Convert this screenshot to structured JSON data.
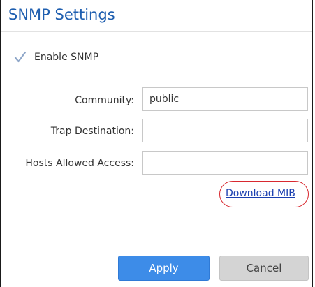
{
  "panel": {
    "title": "SNMP Settings"
  },
  "enable_snmp": {
    "label": "Enable SNMP",
    "checked": true
  },
  "fields": {
    "community": {
      "label": "Community:",
      "value": "public"
    },
    "trap_destination": {
      "label": "Trap Destination:",
      "value": ""
    },
    "hosts_allowed_access": {
      "label": "Hosts Allowed Access:",
      "value": ""
    }
  },
  "links": {
    "download_mib": "Download MIB"
  },
  "buttons": {
    "apply": "Apply",
    "cancel": "Cancel"
  },
  "colors": {
    "title": "#1f5fb0",
    "apply_button": "#3d8ce8",
    "cancel_button": "#d4d4d4",
    "highlight_ring": "#d8282f",
    "link": "#1a3fb0"
  },
  "icons": {
    "checkbox": "checkmark-icon"
  }
}
